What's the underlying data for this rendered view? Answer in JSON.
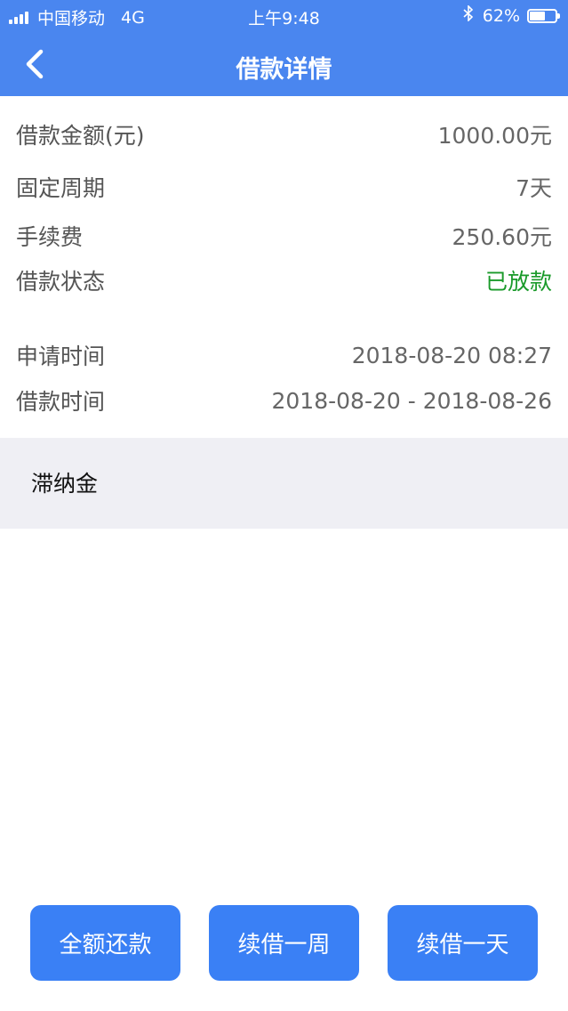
{
  "status_bar": {
    "carrier": "中国移动",
    "network": "4G",
    "time": "上午9:48",
    "bluetooth_icon": "bluetooth-icon",
    "battery_percent_text": "62%",
    "battery_level": 0.62
  },
  "nav": {
    "title": "借款详情",
    "back_icon": "chevron-left-icon"
  },
  "details": {
    "amount_label": "借款金额(元)",
    "amount_value": "1000.00元",
    "period_label": "固定周期",
    "period_value": "7天",
    "fee_label": "手续费",
    "fee_value": "250.60元",
    "status_label": "借款状态",
    "status_value": "已放款",
    "apply_time_label": "申请时间",
    "apply_time_value": "2018-08-20 08:27",
    "loan_time_label": "借款时间",
    "loan_time_value": "2018-08-20 - 2018-08-26"
  },
  "late_fee": {
    "label": "滞纳金"
  },
  "actions": {
    "full_repay": "全额还款",
    "renew_week": "续借一周",
    "renew_day": "续借一天"
  },
  "colors": {
    "header": "#4a86ef",
    "button": "#3a80f5",
    "status_green": "#1a9a2a",
    "band": "#efeff4"
  }
}
